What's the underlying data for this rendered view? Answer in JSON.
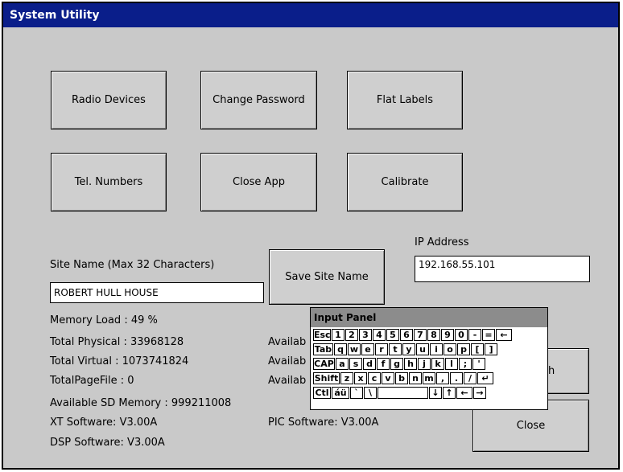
{
  "window": {
    "title": "System Utility"
  },
  "buttons": {
    "radio_devices": "Radio Devices",
    "change_password": "Change Password",
    "flat_labels": "Flat Labels",
    "tel_numbers": "Tel. Numbers",
    "close_app": "Close App",
    "calibrate": "Calibrate",
    "save_site_name": "Save Site Name",
    "hidden_button_fragment": "h",
    "close": "Close"
  },
  "site": {
    "label": "Site Name (Max 32 Characters)",
    "value": "ROBERT HULL HOUSE"
  },
  "ip": {
    "label": "IP Address",
    "value": "192.168.55.101"
  },
  "info": {
    "memory_load": "Memory Load : 49 %",
    "total_physical": "Total Physical : 33968128",
    "total_virtual": "Total Virtual : 1073741824",
    "total_pagefile": "TotalPageFile : 0",
    "available_sd": "Available SD Memory : 999211008",
    "xt_software": "XT Software: V3.00A",
    "dsp_software": "DSP Software: V3.00A",
    "avail_1": "Availab",
    "avail_2": "Availab",
    "avail_3": "Availab",
    "pic_software": "PIC Software: V3.00A"
  },
  "input_panel": {
    "title": "Input Panel",
    "rows": [
      [
        "Esc",
        "1",
        "2",
        "3",
        "4",
        "5",
        "6",
        "7",
        "8",
        "9",
        "0",
        "-",
        "=",
        "←"
      ],
      [
        "Tab",
        "q",
        "w",
        "e",
        "r",
        "t",
        "y",
        "u",
        "i",
        "o",
        "p",
        "[",
        "]"
      ],
      [
        "CAP",
        "a",
        "s",
        "d",
        "f",
        "g",
        "h",
        "j",
        "k",
        "l",
        ";",
        "'"
      ],
      [
        "Shift",
        "z",
        "x",
        "c",
        "v",
        "b",
        "n",
        "m",
        ",",
        ".",
        "/",
        "↵"
      ],
      [
        "Ctl",
        "áü",
        "`",
        "\\",
        " ",
        "↓",
        "↑",
        "←",
        "→"
      ]
    ]
  }
}
